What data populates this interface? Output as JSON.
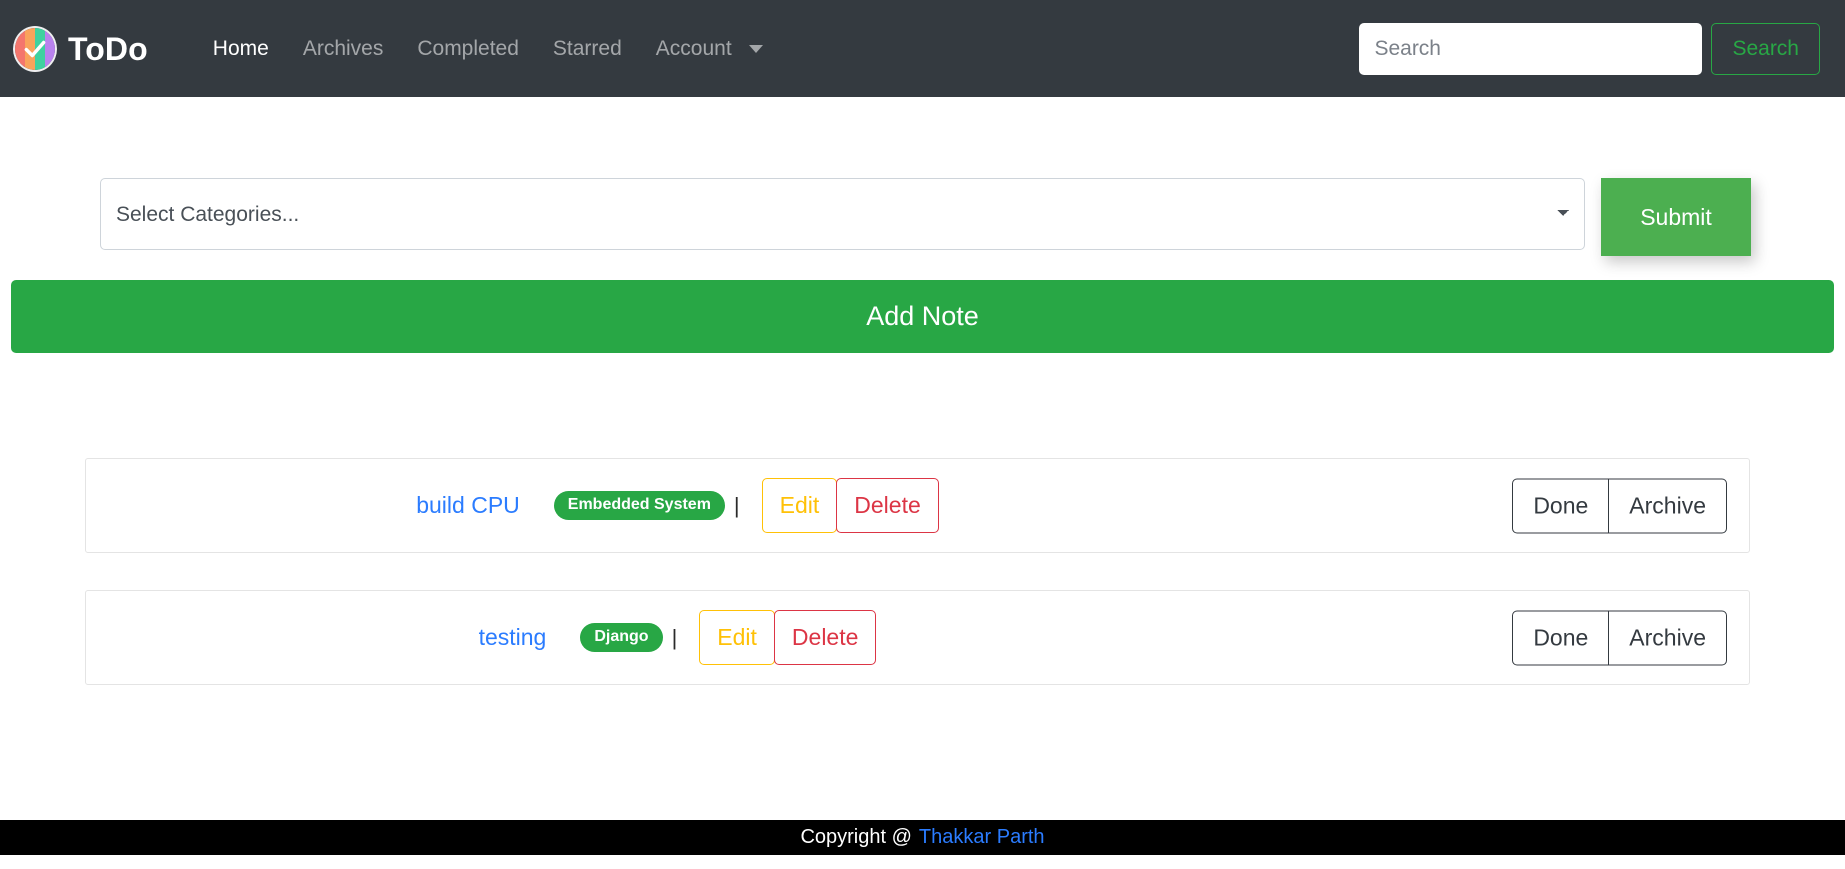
{
  "navbar": {
    "brand": "ToDo",
    "logo_icon": "checkmark-circle-logo",
    "logo_stripe_colors": [
      "#f4766d",
      "#f9a35c",
      "#3fd1a0",
      "#b982ee"
    ],
    "links": [
      {
        "label": "Home",
        "active": true
      },
      {
        "label": "Archives",
        "active": false
      },
      {
        "label": "Completed",
        "active": false
      },
      {
        "label": "Starred",
        "active": false
      },
      {
        "label": "Account",
        "active": false,
        "has_dropdown": true
      }
    ],
    "search": {
      "value": "",
      "placeholder": "Search",
      "button_label": "Search"
    },
    "background_color": "#343a40"
  },
  "filter": {
    "select_value": "Select Categories...",
    "select_icon": "chevron-down-icon",
    "submit_label": "Submit",
    "submit_color": "#4caf50"
  },
  "add_note": {
    "label": "Add Note",
    "color": "#28a745"
  },
  "todos": [
    {
      "title": "build CPU",
      "category": "Embedded System",
      "separator": "|",
      "edit_label": "Edit",
      "delete_label": "Delete",
      "done_label": "Done",
      "archive_label": "Archive"
    },
    {
      "title": "testing",
      "category": "Django",
      "separator": "|",
      "edit_label": "Edit",
      "delete_label": "Delete",
      "done_label": "Done",
      "archive_label": "Archive"
    }
  ],
  "footer": {
    "text": "Copyright @",
    "link_label": "Thakkar Parth",
    "background_color": "#000000",
    "link_color": "#2b7cff"
  }
}
